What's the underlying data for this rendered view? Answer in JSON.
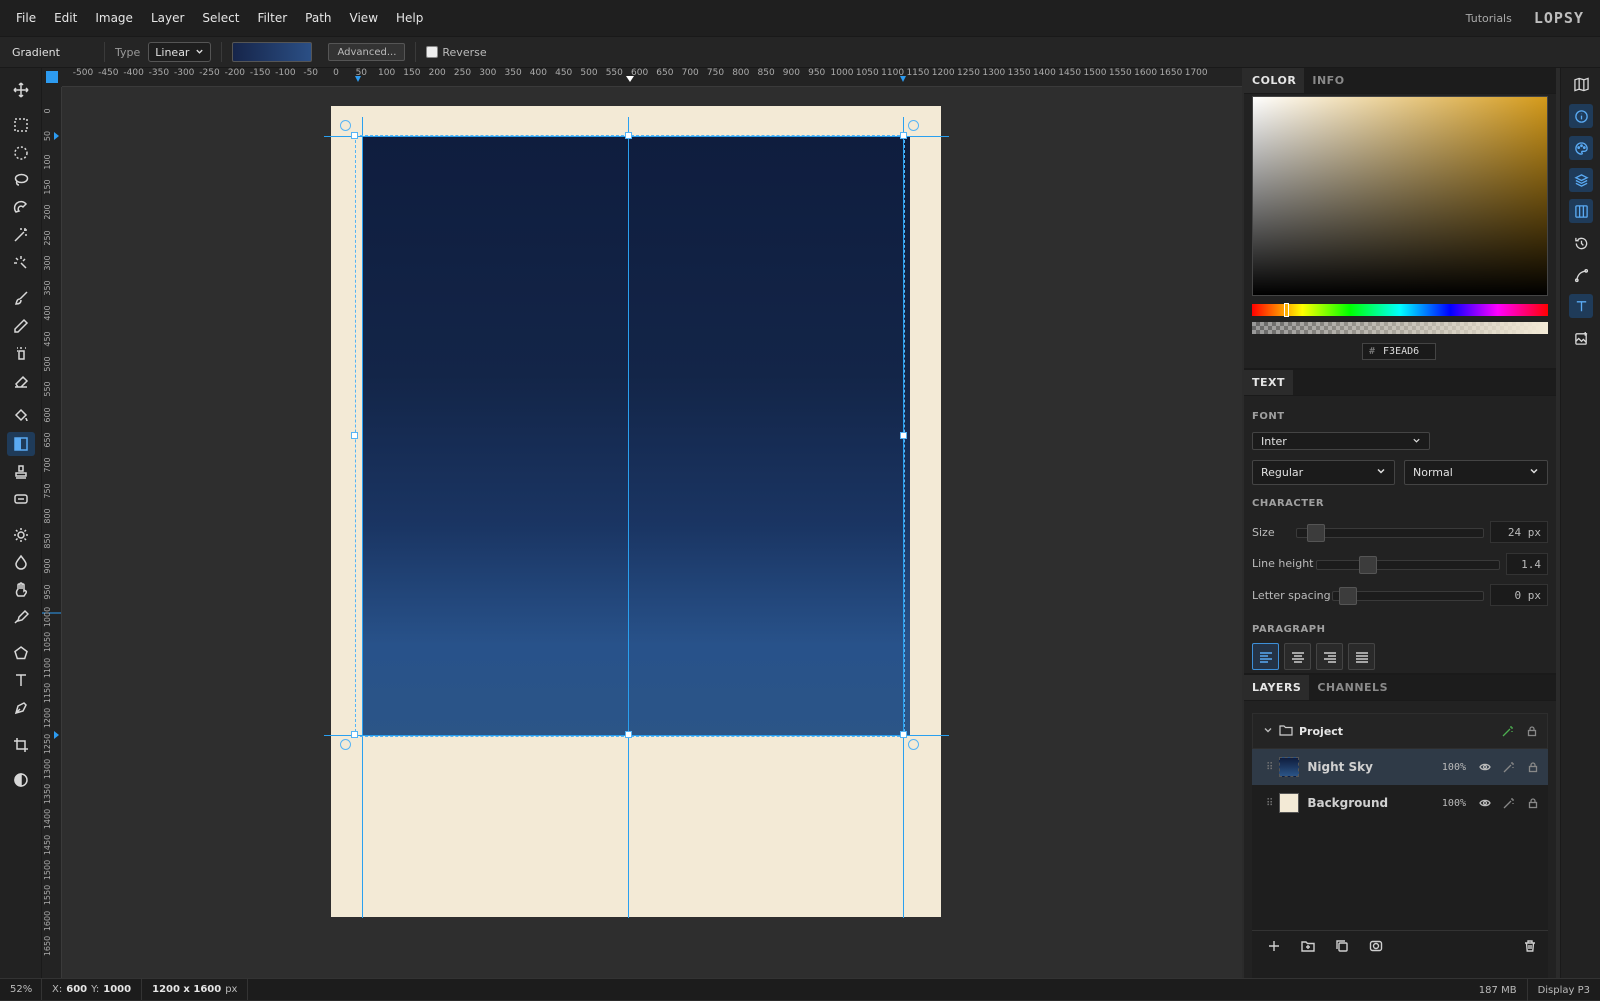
{
  "menu": [
    "File",
    "Edit",
    "Image",
    "Layer",
    "Select",
    "Filter",
    "Path",
    "View",
    "Help"
  ],
  "header": {
    "tutorials": "Tutorials",
    "logo": "LOPSY"
  },
  "options": {
    "tool_name": "Gradient",
    "type_label": "Type",
    "type_value": "Linear",
    "advanced_label": "Advanced...",
    "reverse_label": "Reverse",
    "reverse_checked": false
  },
  "tools": [
    "move-icon",
    "rect-select-icon",
    "ellipse-select-icon",
    "lasso-icon",
    "magnetic-lasso-icon",
    "magic-wand-icon",
    "quick-select-icon",
    "brush-icon",
    "pencil-icon",
    "spray-icon",
    "eraser-icon",
    "paint-bucket-icon",
    "gradient-icon",
    "clone-stamp-icon",
    "healing-icon",
    "dodge-icon",
    "blur-icon",
    "smudge-icon",
    "eyedropper-icon",
    "shape-icon",
    "text-icon",
    "pen-icon",
    "crop-icon",
    "contrast-icon"
  ],
  "active_tool": "gradient-icon",
  "ruler_top": [
    "-500",
    "-450",
    "-400",
    "-350",
    "-300",
    "-250",
    "-200",
    "-150",
    "-100",
    "-50",
    "0",
    "50",
    "100",
    "150",
    "200",
    "250",
    "300",
    "350",
    "400",
    "450",
    "500",
    "550",
    "600",
    "650",
    "700",
    "750",
    "800",
    "850",
    "900",
    "950",
    "1000",
    "1050",
    "1100",
    "1150",
    "1200",
    "1250",
    "1300",
    "1350",
    "1400",
    "1450",
    "1500",
    "1550",
    "1600",
    "1650",
    "1700"
  ],
  "ruler_left": [
    "0",
    "50",
    "100",
    "150",
    "200",
    "250",
    "300",
    "350",
    "400",
    "450",
    "500",
    "550",
    "600",
    "650",
    "700",
    "750",
    "800",
    "850",
    "900",
    "950",
    "1000",
    "1050",
    "1100",
    "1150",
    "1200",
    "1250",
    "1300",
    "1350",
    "1400",
    "1450",
    "1500",
    "1550",
    "1600",
    "1650"
  ],
  "color_panel": {
    "tabs": [
      "COLOR",
      "INFO"
    ],
    "active_tab": "COLOR",
    "hex_hash": "#",
    "hex": "F3EAD6",
    "hue_color": "#d49a1a"
  },
  "text_panel": {
    "title": "TEXT",
    "font_heading": "FONT",
    "font_family": "Inter",
    "font_weight": "Regular",
    "font_style": "Normal",
    "character_heading": "CHARACTER",
    "size_label": "Size",
    "size_value": "24 px",
    "line_height_label": "Line height",
    "line_height_value": "1.4",
    "letter_spacing_label": "Letter spacing",
    "letter_spacing_value": "0 px",
    "paragraph_heading": "PARAGRAPH",
    "active_align": "align-left"
  },
  "layers_panel": {
    "tabs": [
      "LAYERS",
      "CHANNELS"
    ],
    "active_tab": "LAYERS",
    "group_name": "Project",
    "layers": [
      {
        "name": "Night Sky",
        "opacity": "100%",
        "selected": true
      },
      {
        "name": "Background",
        "opacity": "100%",
        "selected": false
      }
    ]
  },
  "status": {
    "zoom": "52%",
    "x_label": "X:",
    "x": "600",
    "y_label": "Y:",
    "y": "1000",
    "doc_size": "1200 x 1600",
    "doc_unit": "px",
    "memory": "187 MB",
    "color_profile": "Display P3"
  },
  "colors": {
    "accent": "#2d9bf0",
    "paper": "#f3ead6",
    "sky_top": "#0f1d3e",
    "sky_bottom": "#2b5587"
  }
}
